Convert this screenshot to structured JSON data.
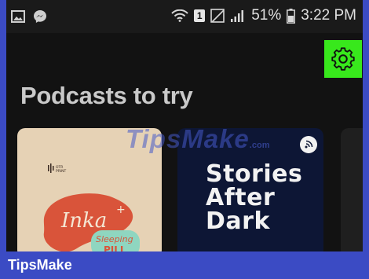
{
  "status_bar": {
    "left_icons": [
      "image-icon",
      "messenger-icon"
    ],
    "notification_count": "1",
    "battery": "51%",
    "time": "3:22 PM"
  },
  "header": {
    "settings_icon": "gear-icon",
    "highlight_color": "#38e81c"
  },
  "section": {
    "title": "Podcasts to try"
  },
  "cards": [
    {
      "logo_text": "OTR PRINT",
      "script_title": "Inka",
      "badge_text_1": "Sleeping",
      "badge_text_2": "PILL"
    },
    {
      "title_lines": [
        "Stories",
        "After",
        "Dark"
      ]
    }
  ],
  "watermark": {
    "text": "TipsMake",
    "suffix": ".com"
  },
  "footer": {
    "brand": "TipsMake"
  }
}
